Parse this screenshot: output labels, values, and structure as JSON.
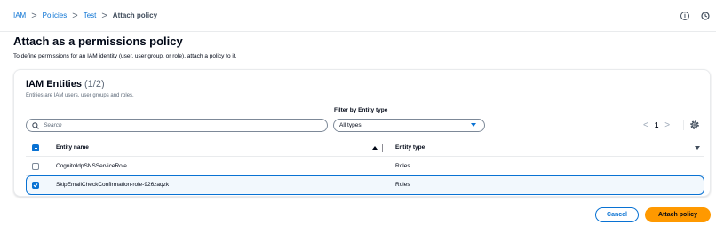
{
  "breadcrumb": {
    "items": [
      "IAM",
      "Policies",
      "Test"
    ],
    "current": "Attach policy",
    "separator": ">"
  },
  "top_icons": [
    "info-icon",
    "clock-icon"
  ],
  "page": {
    "title": "Attach as a permissions policy",
    "description": "To define permissions for an IAM identity (user, user group, or role), attach a policy to it."
  },
  "entities": {
    "title": "IAM Entities",
    "count": "(1/2)",
    "description": "Entities are IAM users, user groups and roles.",
    "search": {
      "placeholder": "Search"
    },
    "filter": {
      "label": "Filter by Entity type",
      "selected": "All types"
    },
    "pagination": {
      "prev": "<",
      "page": "1",
      "next": ">"
    },
    "columns": [
      "Entity name",
      "Entity type"
    ],
    "rows": [
      {
        "name": "CognitoIdpSNSServiceRole",
        "type": "Roles",
        "selected": false
      },
      {
        "name": "SkipEmailCheckConfirmation-role-926zaqzk",
        "type": "Roles",
        "selected": true
      }
    ]
  },
  "actions": {
    "cancel": "Cancel",
    "attach": "Attach policy"
  },
  "colors": {
    "accent": "#0972d3",
    "primary_button": "#ff9900",
    "text": "#000716",
    "muted": "#5f6b7a"
  }
}
